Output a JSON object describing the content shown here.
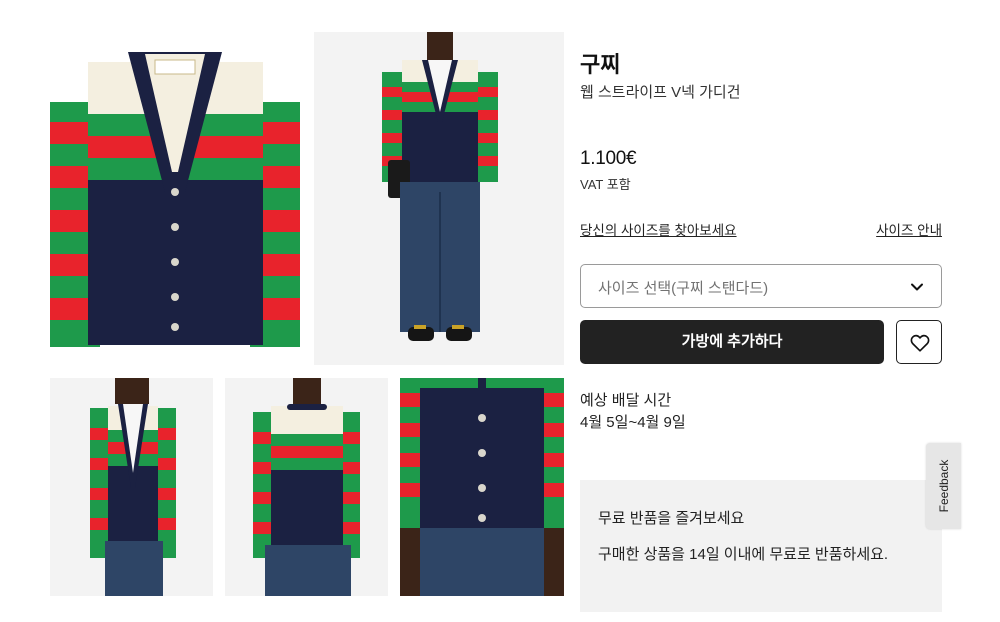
{
  "product": {
    "brand": "구찌",
    "name": "웹 스트라이프 V넥 가디건",
    "price": "1.100€",
    "vat_note": "VAT 포함"
  },
  "size": {
    "find_size_link": "당신의 사이즈를 찾아보세요",
    "size_guide_link": "사이즈 안내",
    "select_placeholder": "사이즈 선택(구찌 스탠다드)"
  },
  "actions": {
    "add_to_bag": "가방에 추가하다"
  },
  "delivery": {
    "title": "예상 배달 시간",
    "dates": "4월 5일~4월 9일"
  },
  "returns": {
    "title": "무료 반품을 즐겨보세요",
    "description": "구매한 상품을 14일 이내에 무료로 반품하세요."
  },
  "feedback": {
    "label": "Feedback"
  },
  "icons": {
    "select": "chevron-down-icon",
    "wishlist": "heart-icon"
  },
  "colors": {
    "navy": "#1b2142",
    "red": "#e8232c",
    "green": "#1e9a4b",
    "cream": "#f4efe0",
    "button_dark": "#222222"
  }
}
